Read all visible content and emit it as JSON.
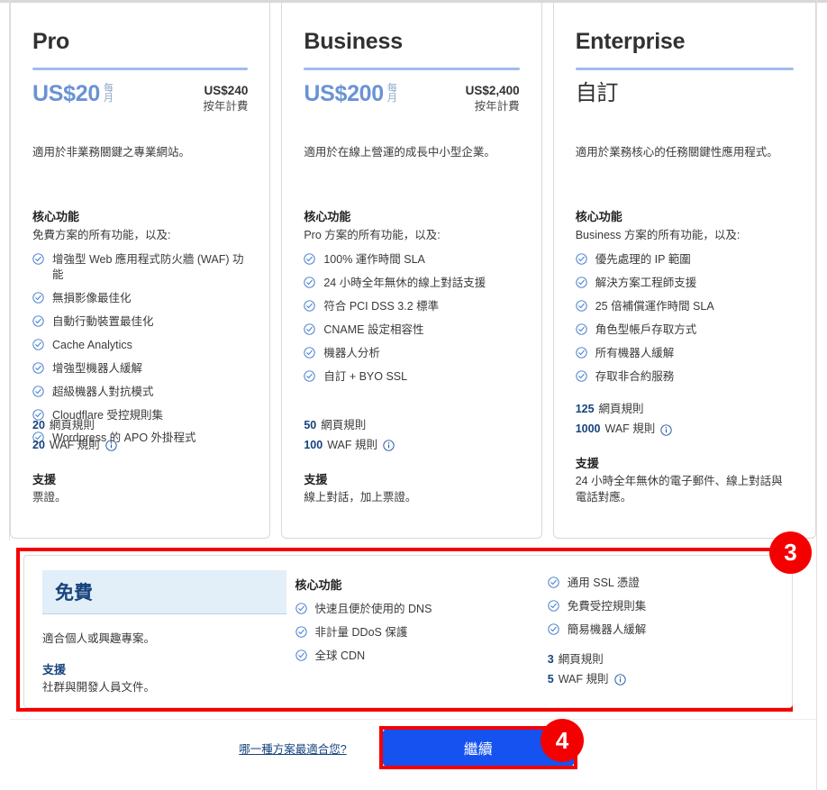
{
  "colors": {
    "accent_blue": "#6a93d4",
    "link_blue": "#16437e",
    "button_blue": "#1552f0",
    "highlight_red": "#f50000",
    "free_head_bg": "#e2eff8"
  },
  "plans": [
    {
      "name": "Pro",
      "price": "US$20",
      "period": "每月",
      "annual_price": "US$240",
      "annual_note": "按年計費",
      "description": "適用於非業務關鍵之專業網站。",
      "features_title": "核心功能",
      "features_sub": "免費方案的所有功能，以及:",
      "features": [
        "增強型 Web 應用程式防火牆 (WAF) 功能",
        "無損影像最佳化",
        "自動行動裝置最佳化",
        "Cache Analytics",
        "增強型機器人緩解",
        "超級機器人對抗模式",
        "Cloudflare 受控規則集",
        "Wordpress 的 APO 外掛程式"
      ],
      "page_rules_count": "20",
      "page_rules_label": "網頁規則",
      "waf_rules_count": "20",
      "waf_rules_label": "WAF 規則",
      "support_title": "支援",
      "support_text": "票證。"
    },
    {
      "name": "Business",
      "price": "US$200",
      "period": "每月",
      "annual_price": "US$2,400",
      "annual_note": "按年計費",
      "description": "適用於在線上營運的成長中小型企業。",
      "features_title": "核心功能",
      "features_sub": "Pro 方案的所有功能，以及:",
      "features": [
        "100% 運作時間 SLA",
        "24 小時全年無休的線上對話支援",
        "符合 PCI DSS 3.2 標準",
        "CNAME 設定相容性",
        "機器人分析",
        "自訂 + BYO SSL"
      ],
      "page_rules_count": "50",
      "page_rules_label": "網頁規則",
      "waf_rules_count": "100",
      "waf_rules_label": "WAF 規則",
      "support_title": "支援",
      "support_text": "線上對話，加上票證。"
    },
    {
      "name": "Enterprise",
      "price": "自訂",
      "period": "",
      "annual_price": "",
      "annual_note": "",
      "description": "適用於業務核心的任務關鍵性應用程式。",
      "features_title": "核心功能",
      "features_sub": "Business 方案的所有功能，以及:",
      "features": [
        "優先處理的 IP 範圍",
        "解決方案工程師支援",
        "25 倍補償運作時間 SLA",
        "角色型帳戶存取方式",
        "所有機器人緩解",
        "存取非合約服務"
      ],
      "page_rules_count": "125",
      "page_rules_label": "網頁規則",
      "waf_rules_count": "1000",
      "waf_rules_label": "WAF 規則",
      "support_title": "支援",
      "support_text": "24 小時全年無休的電子郵件、線上對話與電話對應。"
    }
  ],
  "free_plan": {
    "name": "免費",
    "description": "適合個人或興趣專案。",
    "support_title": "支援",
    "support_text": "社群與開發人員文件。",
    "features_title": "核心功能",
    "features_col1": [
      "快速且便於使用的 DNS",
      "非計量 DDoS 保護",
      "全球 CDN"
    ],
    "features_col2": [
      "通用 SSL 憑證",
      "免費受控規則集",
      "簡易機器人緩解"
    ],
    "page_rules_count": "3",
    "page_rules_label": "網頁規則",
    "waf_rules_count": "5",
    "waf_rules_label": "WAF 規則"
  },
  "footer": {
    "help_link": "哪一種方案最適合您?",
    "continue_label": "繼續"
  },
  "annotations": {
    "badge_free_box": "3",
    "badge_continue": "4"
  }
}
